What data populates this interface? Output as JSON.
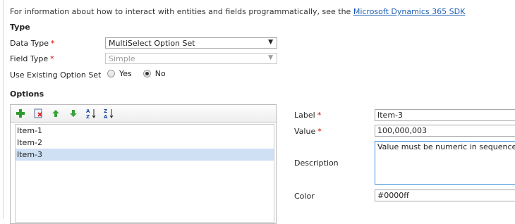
{
  "info": {
    "text": "For information about how to interact with entities and fields programmatically, see the",
    "link": "Microsoft Dynamics 365 SDK"
  },
  "type_section": {
    "heading": "Type",
    "data_type": {
      "label": "Data Type",
      "value": "MultiSelect Option Set",
      "required": "*"
    },
    "field_type": {
      "label": "Field Type",
      "value": "Simple",
      "required": "*"
    },
    "use_existing": {
      "label": "Use Existing Option Set",
      "options": [
        "Yes",
        "No"
      ],
      "selected": "No"
    }
  },
  "options_section": {
    "heading": "Options",
    "toolbar": [
      "add-icon",
      "delete-icon",
      "move-up-icon",
      "move-down-icon",
      "sort-ascending-icon",
      "sort-descending-icon"
    ],
    "items": [
      "Item-1",
      "Item-2",
      "Item-3"
    ],
    "selected_item": "Item-3"
  },
  "properties": {
    "label": {
      "label": "Label",
      "value": "Item-3",
      "required": "*"
    },
    "value": {
      "label": "Value",
      "value": "100,000,003",
      "required": "*"
    },
    "description": {
      "label": "Description",
      "value": "Value must be numeric in sequence"
    },
    "color": {
      "label": "Color",
      "value": "#0000ff"
    }
  },
  "colors": {
    "link": "#1f5fb3",
    "required": "#d00000",
    "selection": "#cfe0f5",
    "focus_border": "#3b8fd9"
  }
}
